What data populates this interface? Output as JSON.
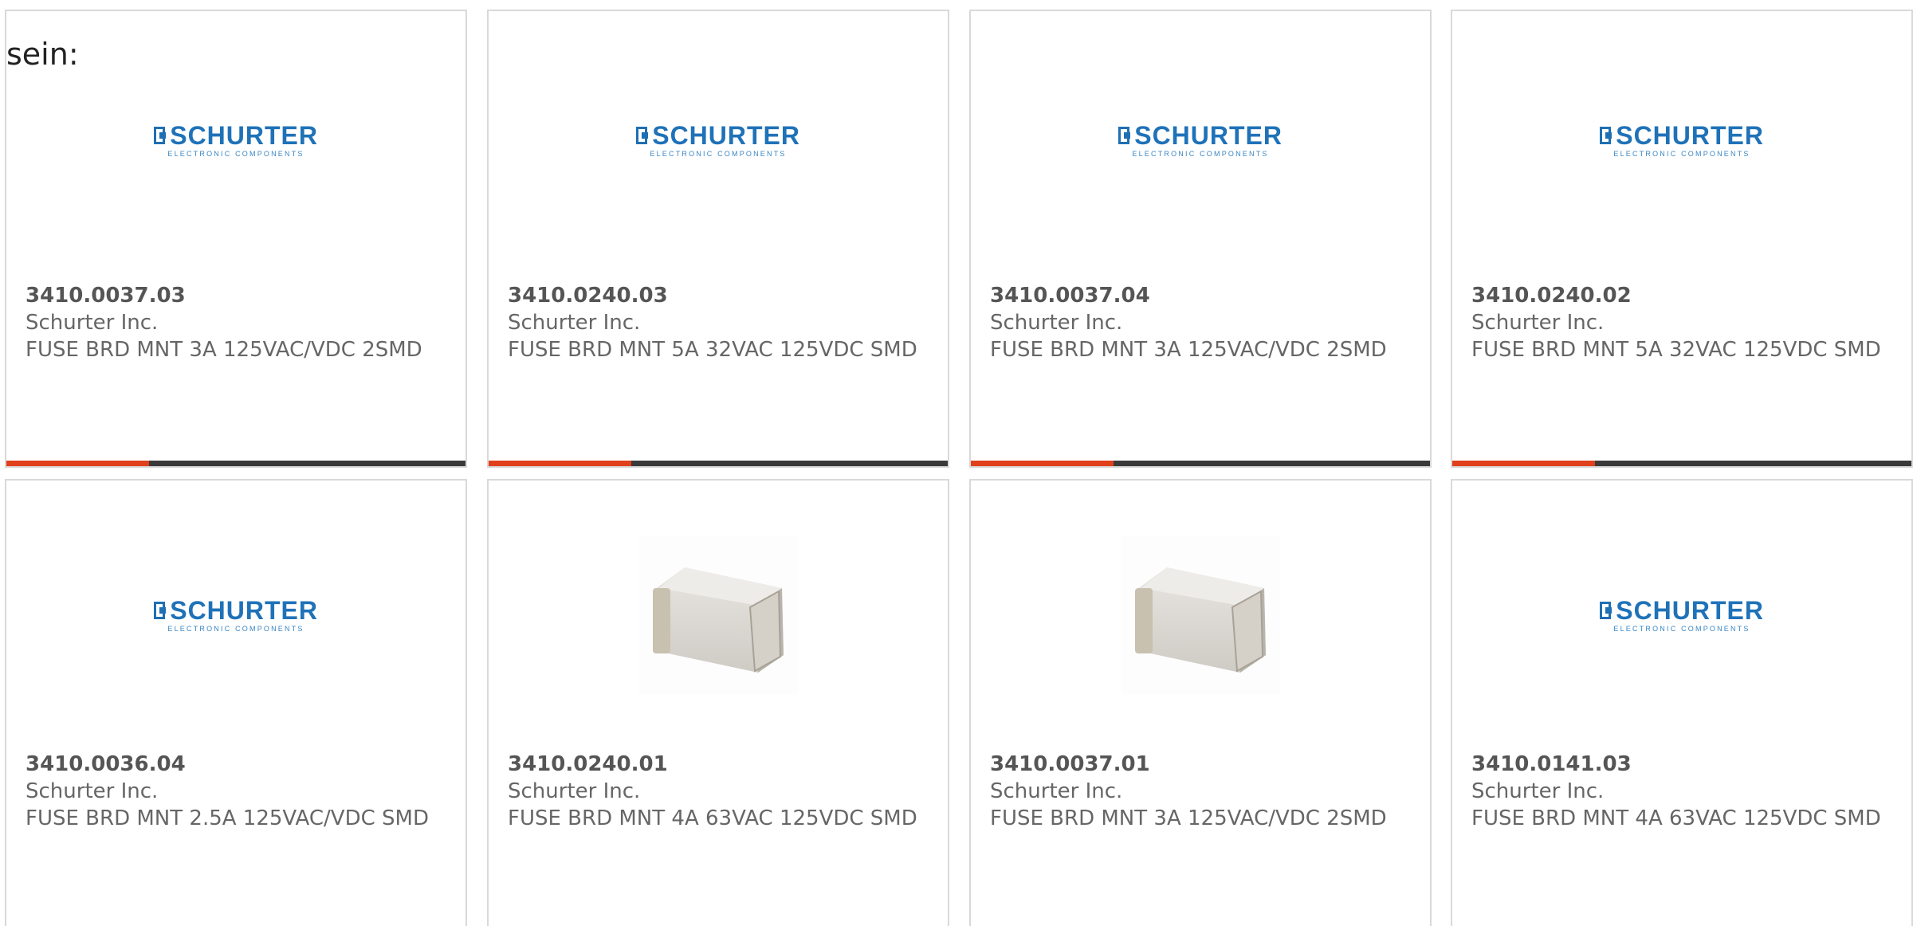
{
  "intro_text": "sein:",
  "logo": {
    "word": "SCHURTER",
    "sub": "ELECTRONIC COMPONENTS",
    "color": "#1f72b8"
  },
  "bar_colors": {
    "fill": "#e0401c",
    "track": "#3a3a3a"
  },
  "cards": [
    {
      "part": "3410.0037.03",
      "maker": "Schurter Inc.",
      "desc": "FUSE BRD MNT 3A 125VAC/VDC 2SMD",
      "image": "schurter-logo",
      "bar_fraction": 0.31
    },
    {
      "part": "3410.0240.03",
      "maker": "Schurter Inc.",
      "desc": "FUSE BRD MNT 5A 32VAC 125VDC SMD",
      "image": "schurter-logo",
      "bar_fraction": 0.31
    },
    {
      "part": "3410.0037.04",
      "maker": "Schurter Inc.",
      "desc": "FUSE BRD MNT 3A 125VAC/VDC 2SMD",
      "image": "schurter-logo",
      "bar_fraction": 0.31
    },
    {
      "part": "3410.0240.02",
      "maker": "Schurter Inc.",
      "desc": "FUSE BRD MNT 5A 32VAC 125VDC SMD",
      "image": "schurter-logo",
      "bar_fraction": 0.31
    },
    {
      "part": "3410.0036.04",
      "maker": "Schurter Inc.",
      "desc": "FUSE BRD MNT 2.5A 125VAC/VDC SMD",
      "image": "schurter-logo"
    },
    {
      "part": "3410.0240.01",
      "maker": "Schurter Inc.",
      "desc": "FUSE BRD MNT 4A 63VAC 125VDC SMD",
      "image": "fuse-photo"
    },
    {
      "part": "3410.0037.01",
      "maker": "Schurter Inc.",
      "desc": "FUSE BRD MNT 3A 125VAC/VDC 2SMD",
      "image": "fuse-photo"
    },
    {
      "part": "3410.0141.03",
      "maker": "Schurter Inc.",
      "desc": "FUSE BRD MNT 4A 63VAC 125VDC SMD",
      "image": "schurter-logo"
    }
  ]
}
